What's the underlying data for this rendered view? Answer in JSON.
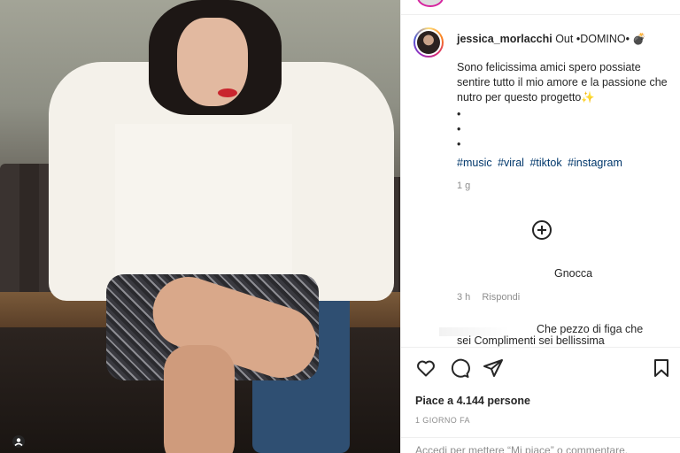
{
  "post": {
    "username": "jessica_morlacchi",
    "caption_title": "Out •DOMINO• 💣",
    "caption_text": "Sono felicissima amici spero possiate sentire tutto il mio amore e la passione che nutro per questo progetto✨",
    "dots": [
      "•",
      "•",
      "•"
    ],
    "hashtags": [
      "#music",
      "#viral",
      "#tiktok",
      "#instagram"
    ],
    "caption_age": "1 g"
  },
  "comments": [
    {
      "text": "Gnocca",
      "age": "3 h",
      "reply_label": "Rispondi"
    },
    {
      "text": "Che pezzo di figa che",
      "text_line2": "sei Complimenti sei bellissima"
    }
  ],
  "actions": {
    "icons": [
      "heart-icon",
      "comment-icon",
      "share-icon",
      "bookmark-icon"
    ]
  },
  "likes_text": "Piace a 4.144 persone",
  "time_ago": "1 GIORNO FA",
  "footer_text": "Accedi per mettere “Mi piace” o commentare.",
  "colors": {
    "hashtag": "#00376b",
    "muted": "#8e8e8e",
    "text": "#262626"
  }
}
